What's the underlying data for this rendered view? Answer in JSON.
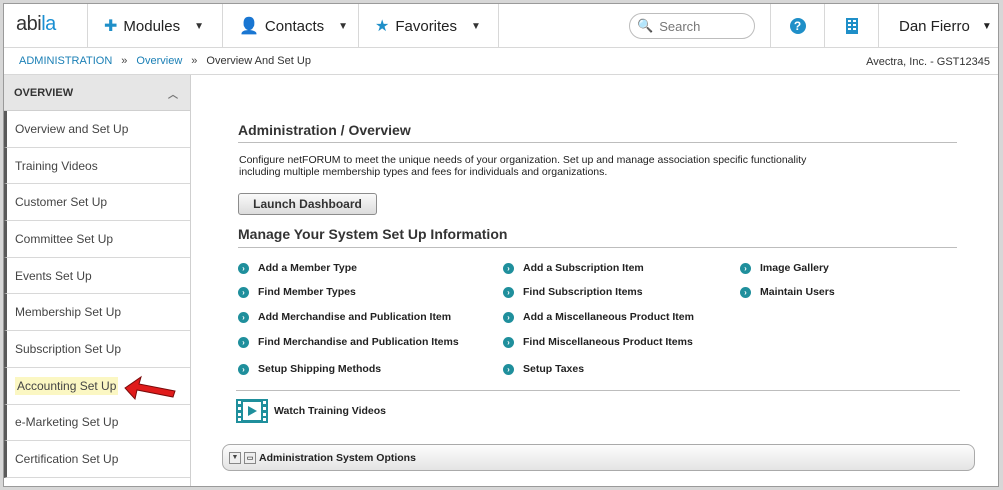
{
  "brand": {
    "logo_text_a": "abi",
    "logo_text_b": "la"
  },
  "topnav": {
    "modules": "Modules",
    "contacts": "Contacts",
    "favorites": "Favorites",
    "search_placeholder": "Search",
    "help": "?",
    "user": "Dan Fierro"
  },
  "breadcrumb": {
    "root": "ADMINISTRATION",
    "sep1": "»",
    "overview": "Overview",
    "sep2": "»",
    "current": "Overview And Set Up",
    "org": "Avectra, Inc. - GST12345"
  },
  "sidebar": {
    "header": "OVERVIEW",
    "items": [
      {
        "label": "Overview and Set Up"
      },
      {
        "label": "Training Videos"
      },
      {
        "label": "Customer Set Up"
      },
      {
        "label": "Committee Set Up"
      },
      {
        "label": "Events Set Up"
      },
      {
        "label": "Membership Set Up"
      },
      {
        "label": "Subscription Set Up"
      },
      {
        "label": "Accounting Set Up"
      },
      {
        "label": "e-Marketing Set Up"
      },
      {
        "label": "Certification Set Up"
      }
    ],
    "highlight_color": "#fbf7c3"
  },
  "main": {
    "title": "Administration / Overview",
    "description": "Configure netFORUM to meet the unique needs of your organization. Set up and manage association specific functionality including multiple membership types and fees for individuals and organizations.",
    "launch_label": "Launch Dashboard",
    "manage_title": "Manage Your System Set Up Information",
    "links": {
      "col1": [
        "Add a Member Type",
        "Find Member Types",
        "Add Merchandise and Publication Item",
        "Find Merchandise and Publication Items",
        "Setup Shipping Methods"
      ],
      "col2": [
        "Add a Subscription Item",
        "Find Subscription Items",
        "Add a Miscellaneous Product Item",
        "Find Miscellaneous Product Items",
        "Setup Taxes"
      ],
      "col3": [
        "Image Gallery",
        "Maintain Users"
      ]
    },
    "training_label": "Watch Training Videos",
    "options_label": "Administration System Options"
  },
  "colors": {
    "accent": "#1f8fc8",
    "link_dot": "#1f8f9c",
    "arrow": "#e01b1b"
  }
}
